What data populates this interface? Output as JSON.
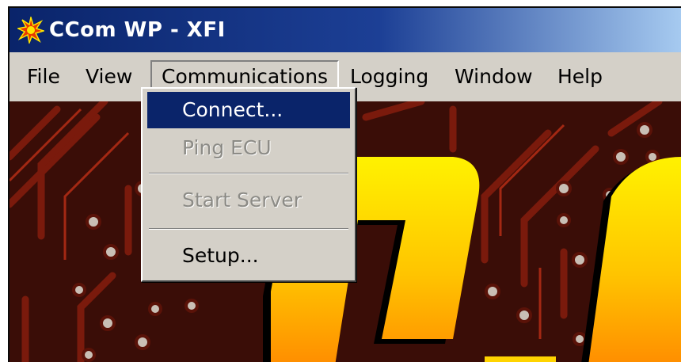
{
  "window": {
    "title": "CCom WP - XFI",
    "app_icon": "starburst-app-icon"
  },
  "menubar": {
    "items": [
      "File",
      "View",
      "Communications",
      "Logging",
      "Window",
      "Help"
    ],
    "active": "Communications"
  },
  "communications_menu": {
    "items": [
      {
        "label": "Connect...",
        "state": "highlighted"
      },
      {
        "label": "Ping ECU",
        "state": "disabled"
      },
      {
        "label": "Start Server",
        "state": "disabled"
      },
      {
        "label": "Setup...",
        "state": "enabled"
      }
    ]
  },
  "colors": {
    "title_bar_start": "#0a246a",
    "title_bar_end": "#a6caf0",
    "menu_face": "#d4d0c8",
    "highlight": "#0a246a",
    "disabled_text": "#8c8b86",
    "circuit_board": "#3a0d07",
    "logo_yellow": "#ffd400"
  }
}
